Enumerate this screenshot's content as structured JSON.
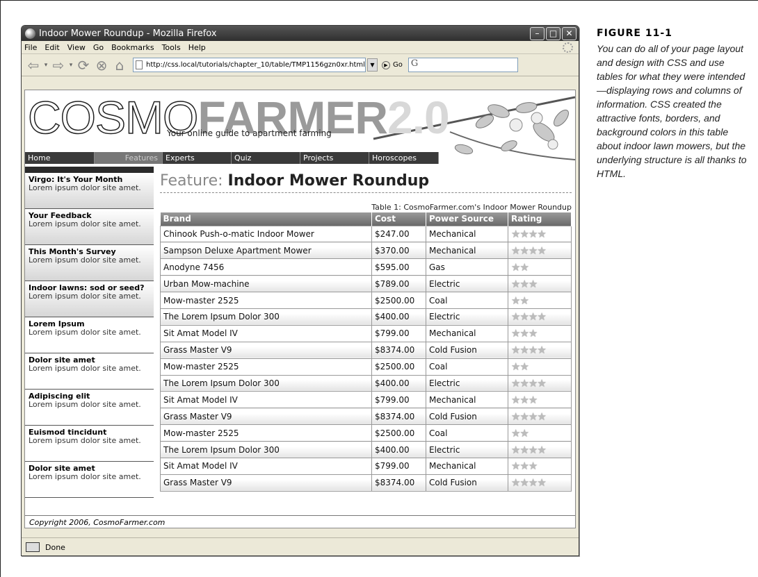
{
  "figure": {
    "label": "FIGURE 11-1",
    "caption": "You can do all of your page layout and design with CSS and use tables for what they were intended—displaying rows and columns of information. CSS created the attractive fonts, borders, and background colors in this table about indoor lawn mowers, but the underlying structure is all thanks to HTML."
  },
  "browser": {
    "title": "Indoor Mower Roundup - Mozilla Firefox",
    "menus": [
      "File",
      "Edit",
      "View",
      "Go",
      "Bookmarks",
      "Tools",
      "Help"
    ],
    "url": "http://css.local/tutorials/chapter_10/table/TMP1156gzn0xr.html",
    "go_label": "Go",
    "search_value": "G",
    "status": "Done"
  },
  "site": {
    "logo_cosmo": "COSMO",
    "logo_farmer": "FARMER",
    "logo_version": "2.0",
    "tagline": "Your online guide to apartment farming",
    "nav": [
      "Home",
      "Features",
      "Experts",
      "Quiz",
      "Projects",
      "Horoscopes"
    ],
    "active_nav": "Features",
    "footer": "Copyright 2006, CosmoFarmer.com"
  },
  "sidebar": [
    {
      "title": "Virgo: It's Your Month",
      "body": "Lorem ipsum dolor site amet."
    },
    {
      "title": "Your Feedback",
      "body": "Lorem ipsum dolor site amet."
    },
    {
      "title": "This Month's Survey",
      "body": "Lorem ipsum dolor site amet."
    },
    {
      "title": "Indoor lawns: sod or seed?",
      "body": "Lorem ipsum dolor site amet."
    },
    {
      "title": "Lorem Ipsum",
      "body": "Lorem ipsum dolor site amet."
    },
    {
      "title": "Dolor site amet",
      "body": "Lorem ipsum dolor site amet."
    },
    {
      "title": "Adipiscing elit",
      "body": "Lorem ipsum dolor site amet."
    },
    {
      "title": "Euismod tincidunt",
      "body": "Lorem ipsum dolor site amet."
    },
    {
      "title": "Dolor site amet",
      "body": "Lorem ipsum dolor site amet."
    }
  ],
  "main": {
    "feature_prefix": "Feature:",
    "feature_title": "Indoor Mower Roundup",
    "table_caption": "Table 1: CosmoFarmer.com's Indoor Mower Roundup",
    "columns": [
      "Brand",
      "Cost",
      "Power Source",
      "Rating"
    ],
    "rows": [
      {
        "brand": "Chinook Push-o-matic Indoor Mower",
        "cost": "$247.00",
        "power": "Mechanical",
        "rating": 4
      },
      {
        "brand": "Sampson Deluxe Apartment Mower",
        "cost": "$370.00",
        "power": "Mechanical",
        "rating": 4
      },
      {
        "brand": "Anodyne 7456",
        "cost": "$595.00",
        "power": "Gas",
        "rating": 2
      },
      {
        "brand": "Urban Mow-machine",
        "cost": "$789.00",
        "power": "Electric",
        "rating": 3
      },
      {
        "brand": "Mow-master 2525",
        "cost": "$2500.00",
        "power": "Coal",
        "rating": 2
      },
      {
        "brand": "The Lorem Ipsum Dolor 300",
        "cost": "$400.00",
        "power": "Electric",
        "rating": 4
      },
      {
        "brand": "Sit Amat Model IV",
        "cost": "$799.00",
        "power": "Mechanical",
        "rating": 3
      },
      {
        "brand": "Grass Master V9",
        "cost": "$8374.00",
        "power": "Cold Fusion",
        "rating": 4
      },
      {
        "brand": "Mow-master 2525",
        "cost": "$2500.00",
        "power": "Coal",
        "rating": 2
      },
      {
        "brand": "The Lorem Ipsum Dolor 300",
        "cost": "$400.00",
        "power": "Electric",
        "rating": 4
      },
      {
        "brand": "Sit Amat Model IV",
        "cost": "$799.00",
        "power": "Mechanical",
        "rating": 3
      },
      {
        "brand": "Grass Master V9",
        "cost": "$8374.00",
        "power": "Cold Fusion",
        "rating": 4
      },
      {
        "brand": "Mow-master 2525",
        "cost": "$2500.00",
        "power": "Coal",
        "rating": 2
      },
      {
        "brand": "The Lorem Ipsum Dolor 300",
        "cost": "$400.00",
        "power": "Electric",
        "rating": 4
      },
      {
        "brand": "Sit Amat Model IV",
        "cost": "$799.00",
        "power": "Mechanical",
        "rating": 3
      },
      {
        "brand": "Grass Master V9",
        "cost": "$8374.00",
        "power": "Cold Fusion",
        "rating": 4
      }
    ]
  }
}
